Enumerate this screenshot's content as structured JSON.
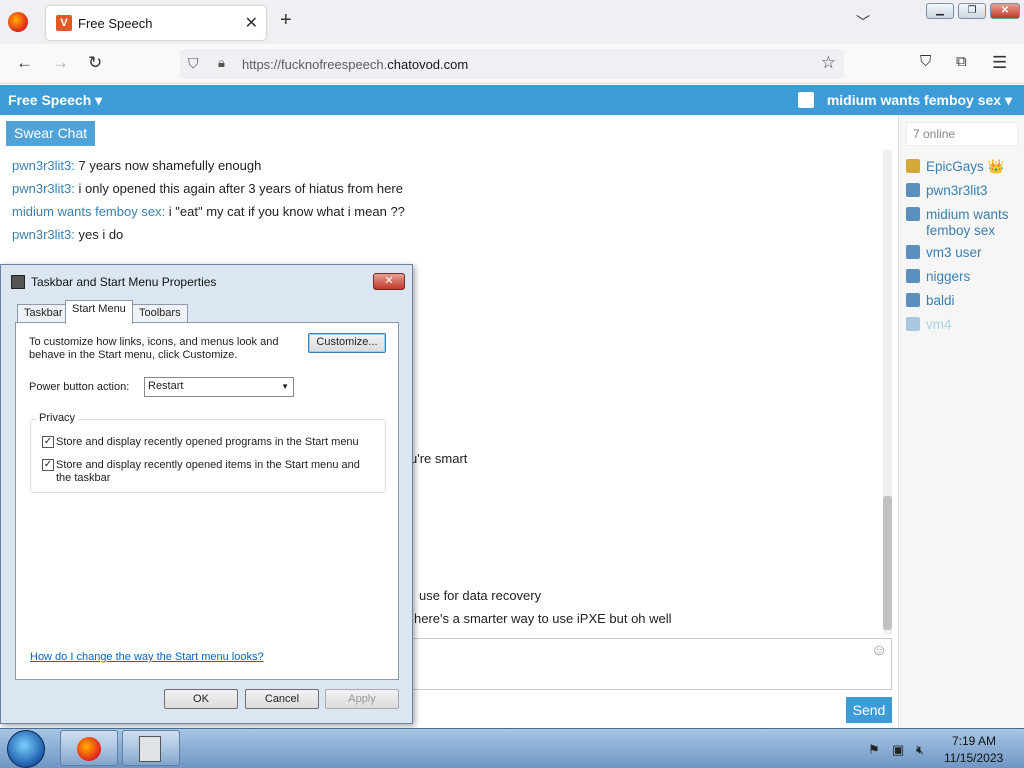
{
  "browser": {
    "tab_title": "Free Speech",
    "tab_icon_letter": "V",
    "url_prefix": "https://fucknofreespeech.",
    "url_domain": "chatovod.com"
  },
  "site": {
    "title": "Free Speech ▾",
    "user": "midium wants femboy sex ▾",
    "chat_tab": "Swear Chat",
    "send_label": "Send",
    "accent": "#3d9bd7"
  },
  "messages": [
    {
      "nick": "pwn3r3lit3:",
      "text": " 7 years now shamefully enough"
    },
    {
      "nick": "pwn3r3lit3:",
      "text": " i only opened this again after 3 years of hiatus from here"
    },
    {
      "nick": "midium wants femboy sex:",
      "text": " i \"eat\" my cat if you know what i mean ??"
    },
    {
      "nick": "pwn3r3lit3:",
      "text": " yes i do"
    }
  ],
  "partial_messages": [
    "u're smart",
    "use for data recovery",
    "here's a smarter way to use iPXE but oh well"
  ],
  "sidebar": {
    "online_count": "7 online",
    "users": [
      "EpicGays 👑",
      "pwn3r3lit3",
      "midium wants femboy sex",
      "vm3 user",
      "niggers",
      "baldi",
      "vm4"
    ]
  },
  "dialog": {
    "title": "Taskbar and Start Menu Properties",
    "tabs": [
      "Taskbar",
      "Start Menu",
      "Toolbars"
    ],
    "desc": "To customize how links, icons, and menus look and behave in the Start menu, click Customize.",
    "customize_label": "Customize...",
    "power_label": "Power button action:",
    "power_value": "Restart",
    "privacy_label": "Privacy",
    "check1": "Store and display recently opened programs in the Start menu",
    "check2": "Store and display recently opened items in the Start menu and the taskbar",
    "help_link": "How do I change the way the Start menu looks?",
    "ok": "OK",
    "cancel": "Cancel",
    "apply": "Apply"
  },
  "taskbar": {
    "time": "7:19 AM",
    "date": "11/15/2023"
  }
}
